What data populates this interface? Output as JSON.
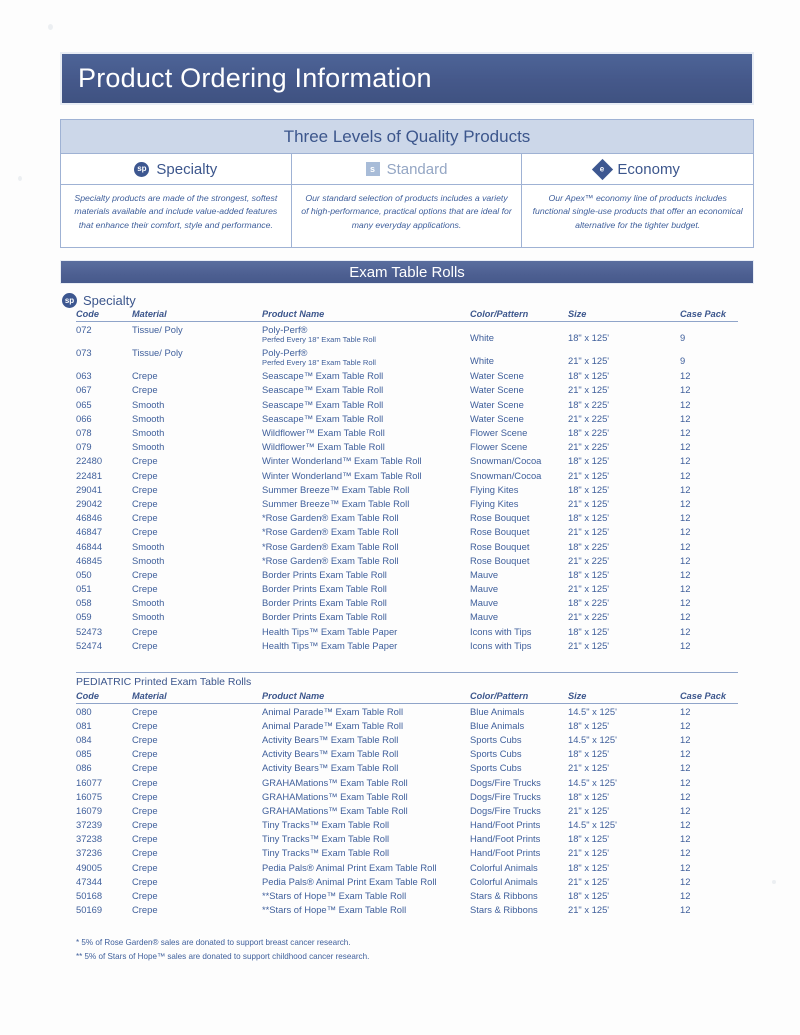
{
  "document": {
    "title": "Product Ordering Information"
  },
  "quality": {
    "heading": "Three Levels of Quality Products",
    "levels": [
      {
        "icon": "sp",
        "name": "Specialty",
        "description": "Specialty products are made of the strongest, softest materials available and include value-added features that enhance their comfort, style and performance."
      },
      {
        "icon": "s",
        "name": "Standard",
        "description": "Our standard selection of products includes a variety of high-performance, practical options that are ideal for many everyday applications."
      },
      {
        "icon": "e",
        "name": "Economy",
        "description": "Our Apex™ economy line of products includes functional single-use products that offer an economical alternative for the tighter budget."
      }
    ]
  },
  "section": {
    "banner": "Exam Table Rolls",
    "tier_label": "Specialty",
    "tier_icon": "sp"
  },
  "columns": {
    "code": "Code",
    "material": "Material",
    "product_name": "Product Name",
    "color_pattern": "Color/Pattern",
    "size": "Size",
    "case_pack": "Case Pack"
  },
  "specialty_rows": [
    {
      "code": "072",
      "material": "Tissue/ Poly",
      "product": "Poly-Perf®",
      "product_sub": "Perfed Every 18\" Exam Table Roll",
      "color": "White",
      "size": "18\" x 125'",
      "pack": "9"
    },
    {
      "code": "073",
      "material": "Tissue/ Poly",
      "product": "Poly-Perf®",
      "product_sub": "Perfed Every 18\" Exam Table Roll",
      "color": "White",
      "size": "21\" x 125'",
      "pack": "9"
    },
    {
      "code": "063",
      "material": "Crepe",
      "product": "Seascape™ Exam Table Roll",
      "color": "Water Scene",
      "size": "18\" x 125'",
      "pack": "12"
    },
    {
      "code": "067",
      "material": "Crepe",
      "product": "Seascape™ Exam Table Roll",
      "color": "Water Scene",
      "size": "21\" x 125'",
      "pack": "12"
    },
    {
      "code": "065",
      "material": "Smooth",
      "product": "Seascape™ Exam Table Roll",
      "color": "Water Scene",
      "size": "18\" x 225'",
      "pack": "12"
    },
    {
      "code": "066",
      "material": "Smooth",
      "product": "Seascape™ Exam Table Roll",
      "color": "Water Scene",
      "size": "21\" x 225'",
      "pack": "12"
    },
    {
      "code": "078",
      "material": "Smooth",
      "product": "Wildflower™ Exam Table Roll",
      "color": "Flower Scene",
      "size": "18\" x 225'",
      "pack": "12"
    },
    {
      "code": "079",
      "material": "Smooth",
      "product": "Wildflower™ Exam Table Roll",
      "color": "Flower Scene",
      "size": "21\" x 225'",
      "pack": "12"
    },
    {
      "code": "22480",
      "material": "Crepe",
      "product": "Winter Wonderland™ Exam Table Roll",
      "color": "Snowman/Cocoa",
      "size": "18\" x 125'",
      "pack": "12"
    },
    {
      "code": "22481",
      "material": "Crepe",
      "product": "Winter Wonderland™ Exam Table Roll",
      "color": "Snowman/Cocoa",
      "size": "21\" x 125'",
      "pack": "12"
    },
    {
      "code": "29041",
      "material": "Crepe",
      "product": "Summer Breeze™ Exam Table Roll",
      "color": "Flying Kites",
      "size": "18\" x 125'",
      "pack": "12"
    },
    {
      "code": "29042",
      "material": "Crepe",
      "product": "Summer Breeze™ Exam Table Roll",
      "color": "Flying Kites",
      "size": "21\" x 125'",
      "pack": "12"
    },
    {
      "code": "46846",
      "material": "Crepe",
      "product": "*Rose Garden® Exam Table Roll",
      "color": "Rose Bouquet",
      "size": "18\" x 125'",
      "pack": "12"
    },
    {
      "code": "46847",
      "material": "Crepe",
      "product": "*Rose Garden® Exam Table Roll",
      "color": "Rose Bouquet",
      "size": "21\" x 125'",
      "pack": "12"
    },
    {
      "code": "46844",
      "material": "Smooth",
      "product": "*Rose Garden® Exam Table Roll",
      "color": "Rose Bouquet",
      "size": "18\" x 225'",
      "pack": "12"
    },
    {
      "code": "46845",
      "material": "Smooth",
      "product": "*Rose Garden® Exam Table Roll",
      "color": "Rose Bouquet",
      "size": "21\" x 225'",
      "pack": "12"
    },
    {
      "code": "050",
      "material": "Crepe",
      "product": "Border Prints Exam Table Roll",
      "color": "Mauve",
      "size": "18\" x 125'",
      "pack": "12"
    },
    {
      "code": "051",
      "material": "Crepe",
      "product": "Border Prints Exam Table Roll",
      "color": "Mauve",
      "size": "21\" x 125'",
      "pack": "12"
    },
    {
      "code": "058",
      "material": "Smooth",
      "product": "Border Prints Exam Table Roll",
      "color": "Mauve",
      "size": "18\" x 225'",
      "pack": "12"
    },
    {
      "code": "059",
      "material": "Smooth",
      "product": "Border Prints Exam Table Roll",
      "color": "Mauve",
      "size": "21\" x 225'",
      "pack": "12"
    },
    {
      "code": "52473",
      "material": "Crepe",
      "product": "Health Tips™ Exam Table Paper",
      "color": "Icons with Tips",
      "size": "18\" x 125'",
      "pack": "12"
    },
    {
      "code": "52474",
      "material": "Crepe",
      "product": "Health Tips™ Exam Table Paper",
      "color": "Icons with Tips",
      "size": "21\" x 125'",
      "pack": "12"
    }
  ],
  "pediatric": {
    "title": "PEDIATRIC Printed Exam Table Rolls",
    "rows": [
      {
        "code": "080",
        "material": "Crepe",
        "product": "Animal Parade™ Exam Table Roll",
        "color": "Blue Animals",
        "size": "14.5\" x 125'",
        "pack": "12"
      },
      {
        "code": "081",
        "material": "Crepe",
        "product": "Animal Parade™ Exam Table Roll",
        "color": "Blue Animals",
        "size": "18\" x 125'",
        "pack": "12"
      },
      {
        "code": "084",
        "material": "Crepe",
        "product": "Activity Bears™ Exam Table Roll",
        "color": "Sports Cubs",
        "size": "14.5\" x 125'",
        "pack": "12"
      },
      {
        "code": "085",
        "material": "Crepe",
        "product": "Activity Bears™ Exam Table Roll",
        "color": "Sports Cubs",
        "size": "18\" x 125'",
        "pack": "12"
      },
      {
        "code": "086",
        "material": "Crepe",
        "product": "Activity Bears™ Exam Table Roll",
        "color": "Sports Cubs",
        "size": "21\" x 125'",
        "pack": "12"
      },
      {
        "code": "16077",
        "material": "Crepe",
        "product": "GRAHAMations™ Exam Table Roll",
        "color": "Dogs/Fire Trucks",
        "size": "14.5\" x 125'",
        "pack": "12"
      },
      {
        "code": "16075",
        "material": "Crepe",
        "product": "GRAHAMations™ Exam Table Roll",
        "color": "Dogs/Fire Trucks",
        "size": "18\" x 125'",
        "pack": "12"
      },
      {
        "code": "16079",
        "material": "Crepe",
        "product": "GRAHAMations™ Exam Table Roll",
        "color": "Dogs/Fire Trucks",
        "size": "21\" x 125'",
        "pack": "12"
      },
      {
        "code": "37239",
        "material": "Crepe",
        "product": "Tiny Tracks™ Exam Table Roll",
        "color": "Hand/Foot Prints",
        "size": "14.5\" x 125'",
        "pack": "12"
      },
      {
        "code": "37238",
        "material": "Crepe",
        "product": "Tiny Tracks™ Exam Table Roll",
        "color": "Hand/Foot Prints",
        "size": "18\" x 125'",
        "pack": "12"
      },
      {
        "code": "37236",
        "material": "Crepe",
        "product": "Tiny Tracks™ Exam Table Roll",
        "color": "Hand/Foot Prints",
        "size": "21\" x 125'",
        "pack": "12"
      },
      {
        "code": "49005",
        "material": "Crepe",
        "product": "Pedia Pals® Animal Print Exam Table Roll",
        "color": "Colorful Animals",
        "size": "18\" x 125'",
        "pack": "12"
      },
      {
        "code": "47344",
        "material": "Crepe",
        "product": "Pedia Pals® Animal Print Exam Table Roll",
        "color": "Colorful Animals",
        "size": "21\" x 125'",
        "pack": "12"
      },
      {
        "code": "50168",
        "material": "Crepe",
        "product": "**Stars of Hope™ Exam Table Roll",
        "color": "Stars & Ribbons",
        "size": "18\" x 125'",
        "pack": "12"
      },
      {
        "code": "50169",
        "material": "Crepe",
        "product": "**Stars of Hope™ Exam Table Roll",
        "color": "Stars & Ribbons",
        "size": "21\" x 125'",
        "pack": "12"
      }
    ]
  },
  "footnotes": [
    "* 5% of Rose Garden® sales are donated to support breast cancer research.",
    "** 5% of Stars of Hope™ sales are donated to support childhood cancer research."
  ],
  "colors": {
    "banner_blue": "#4a5f8e",
    "panel_blue": "#ccd7e9",
    "text_blue": "#3f5f9b",
    "rule_blue": "#8fa4c9"
  }
}
